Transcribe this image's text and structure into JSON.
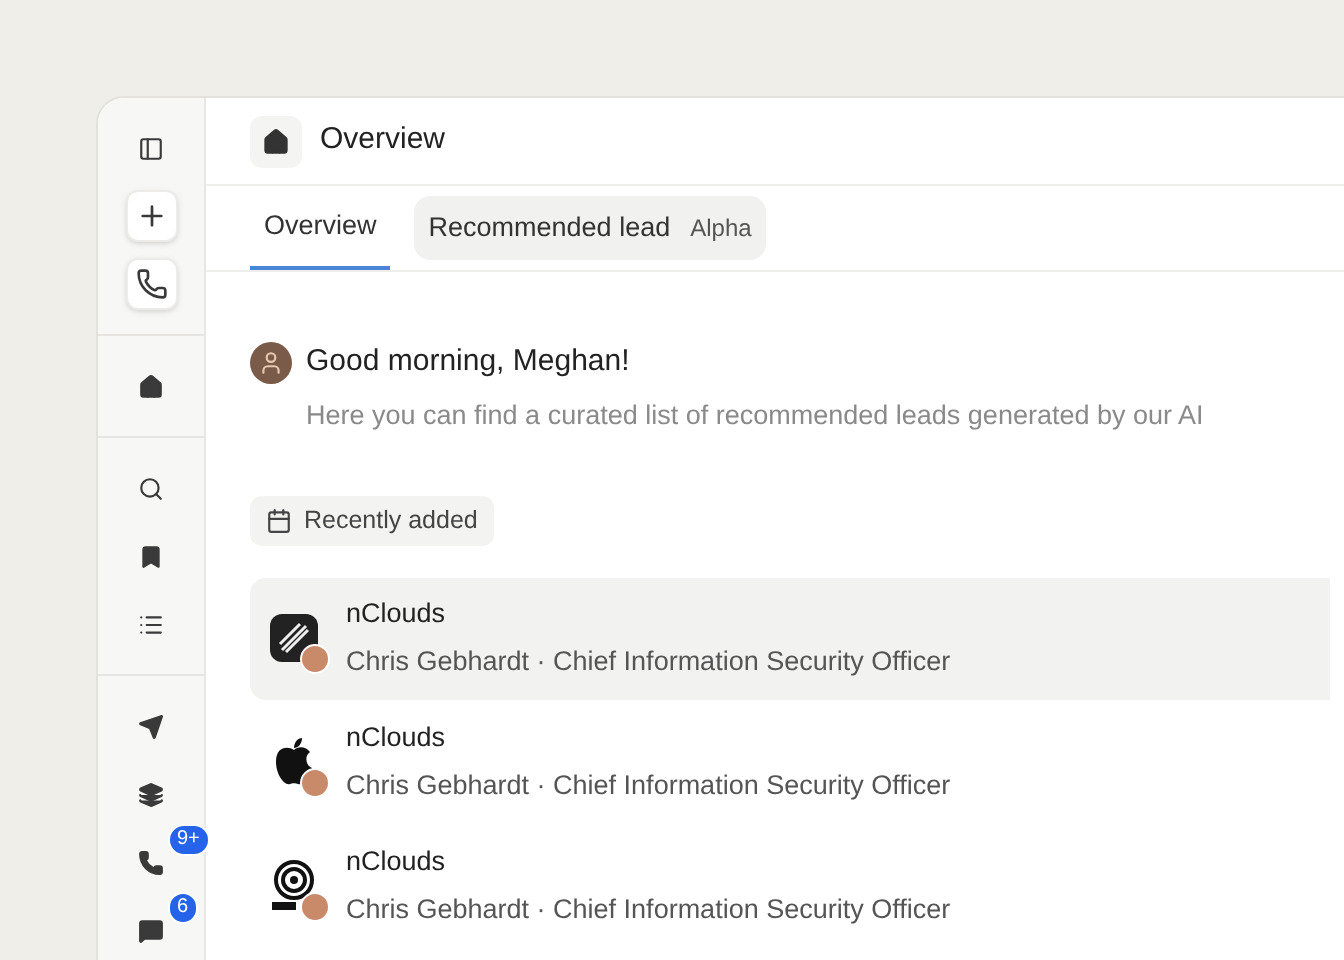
{
  "sidebar": {
    "groups": [
      [
        {
          "kind": "panel",
          "boxed": false
        },
        {
          "kind": "plus",
          "boxed": true
        },
        {
          "kind": "phone",
          "boxed": true
        }
      ],
      [
        {
          "kind": "home",
          "boxed": false
        }
      ],
      [
        {
          "kind": "search",
          "boxed": false
        },
        {
          "kind": "bookmark",
          "boxed": false
        },
        {
          "kind": "list",
          "boxed": false
        }
      ],
      [
        {
          "kind": "send",
          "boxed": false
        },
        {
          "kind": "layers",
          "boxed": false
        },
        {
          "kind": "phone",
          "boxed": false,
          "badge": "9+"
        },
        {
          "kind": "message",
          "boxed": false,
          "badge": "6"
        }
      ]
    ]
  },
  "header": {
    "title": "Overview"
  },
  "tabs": [
    {
      "label": "Overview",
      "selected": true
    },
    {
      "label": "Recommended lead",
      "tag": "Alpha",
      "selected": false
    }
  ],
  "greeting": {
    "title": "Good morning, Meghan!",
    "subtitle": "Here you can find a curated list of recommended leads generated by our AI"
  },
  "filter": {
    "label": "Recently added"
  },
  "leads": [
    {
      "company": "nClouds",
      "contact": "Chris Gebhardt · Chief Information Security Officer",
      "kind": "squircle",
      "selected": true
    },
    {
      "company": "nClouds",
      "contact": "Chris Gebhardt · Chief Information Security Officer",
      "kind": "apple",
      "selected": false
    },
    {
      "company": "nClouds",
      "contact": "Chris Gebhardt · Chief Information Security Officer",
      "kind": "spiral",
      "selected": false
    }
  ]
}
